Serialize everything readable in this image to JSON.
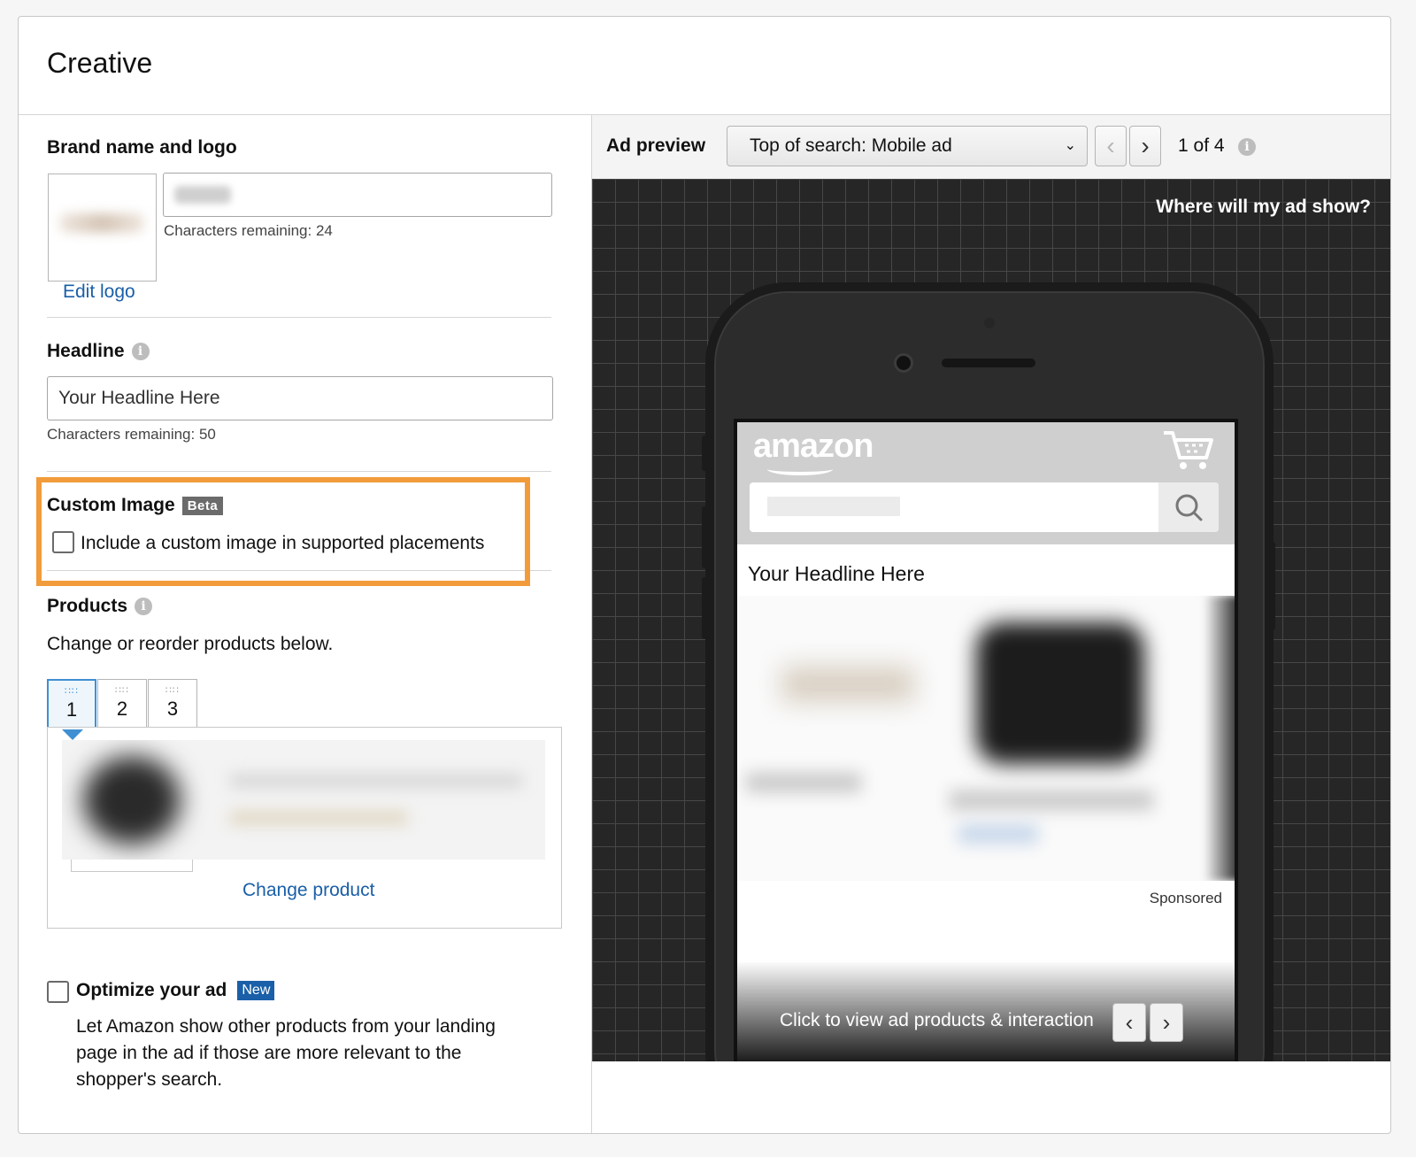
{
  "card": {
    "title": "Creative"
  },
  "brand": {
    "label": "Brand name and logo",
    "chars_remaining": "Characters remaining: 24",
    "edit_logo": "Edit logo"
  },
  "headline": {
    "label": "Headline",
    "value": "Your Headline Here",
    "chars_remaining": "Characters remaining: 50"
  },
  "custom_image": {
    "label": "Custom Image",
    "badge": "Beta",
    "checkbox_label": "Include a custom image in supported placements",
    "checked": false
  },
  "products": {
    "label": "Products",
    "description": "Change or reorder products below.",
    "tabs": [
      "1",
      "2",
      "3"
    ],
    "active_tab": "1",
    "change_product": "Change product"
  },
  "optimize": {
    "label": "Optimize your ad",
    "badge": "New",
    "description_line1": "Let Amazon show other products from your landing",
    "description_line2": "page in the ad if those are more relevant to the",
    "description_line3": "shopper's search.",
    "checked": false
  },
  "ad_preview": {
    "label": "Ad preview",
    "placement": "Top of search: Mobile ad",
    "pager": "1 of 4",
    "where_link": "Where will my ad show?",
    "mock": {
      "store_logo": "amazon",
      "headline": "Your Headline Here",
      "sponsored": "Sponsored",
      "footer_text": "Click to view ad products & interaction"
    }
  },
  "colors": {
    "highlight": "#f29b3a",
    "link": "#1a5fa8",
    "new_badge": "#1a5fa8",
    "beta_badge": "#6b6b6b",
    "preview_bg": "#262626"
  },
  "icons": [
    "info-icon",
    "checkbox-icon",
    "chevron-left-icon",
    "chevron-right-icon",
    "chevron-down-icon",
    "cart-icon",
    "search-icon",
    "drag-grip-icon"
  ]
}
